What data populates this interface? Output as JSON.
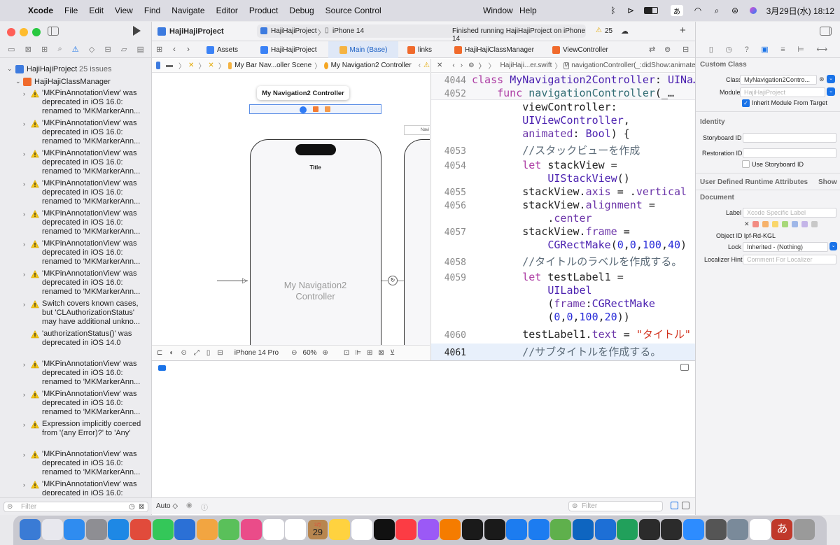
{
  "menubar": {
    "app": "Xcode",
    "items": [
      "File",
      "Edit",
      "View",
      "Find",
      "Navigate",
      "Editor",
      "Product",
      "Debug",
      "Source Control"
    ],
    "center_items": [
      "Window",
      "Help"
    ],
    "input_mode": "あ",
    "datetime": "3月29日(水)  18:12"
  },
  "toolbar": {
    "project": "HajiHajiProject",
    "scheme": "HajiHajiProject",
    "device": "iPhone 14",
    "status": "Finished running HajiHajiProject on iPhone 14",
    "warning_count": "25"
  },
  "navigator": {
    "project_name": "HajiHajiProject",
    "issue_count": "25 issues",
    "group": "HajiHajiClassManager",
    "issues": [
      {
        "text": "'MKPinAnnotationView' was\ndeprecated in iOS 16.0:\nrenamed to 'MKMarkerAnn...",
        "chevron": true
      },
      {
        "text": "'MKPinAnnotationView' was\ndeprecated in iOS 16.0:\nrenamed to 'MKMarkerAnn...",
        "chevron": true
      },
      {
        "text": "'MKPinAnnotationView' was\ndeprecated in iOS 16.0:\nrenamed to 'MKMarkerAnn...",
        "chevron": true
      },
      {
        "text": "'MKPinAnnotationView' was\ndeprecated in iOS 16.0:\nrenamed to 'MKMarkerAnn...",
        "chevron": true
      },
      {
        "text": "'MKPinAnnotationView' was\ndeprecated in iOS 16.0:\nrenamed to 'MKMarkerAnn...",
        "chevron": true
      },
      {
        "text": "'MKPinAnnotationView' was\ndeprecated in iOS 16.0:\nrenamed to 'MKMarkerAnn...",
        "chevron": true
      },
      {
        "text": "'MKPinAnnotationView' was\ndeprecated in iOS 16.0:\nrenamed to 'MKMarkerAnn...",
        "chevron": true
      },
      {
        "text": "Switch covers known cases,\nbut 'CLAuthorizationStatus'\nmay have additional unkno...",
        "chevron": true
      },
      {
        "text": "'authorizationStatus()' was\ndeprecated in iOS 14.0",
        "chevron": false
      },
      {
        "text": "'MKPinAnnotationView' was\ndeprecated in iOS 16.0:\nrenamed to 'MKMarkerAnn...",
        "chevron": true
      },
      {
        "text": "'MKPinAnnotationView' was\ndeprecated in iOS 16.0:\nrenamed to 'MKMarkerAnn...",
        "chevron": true
      },
      {
        "text": "Expression implicitly coerced\nfrom '(any Error)?' to 'Any'",
        "chevron": true
      },
      {
        "text": "'MKPinAnnotationView' was\ndeprecated in iOS 16.0:\nrenamed to 'MKMarkerAnn...",
        "chevron": true
      },
      {
        "text": "'MKPinAnnotationView' was\ndeprecated in iOS 16.0:\nrenamed to 'MKMarkerAnn...",
        "chevron": true
      },
      {
        "text": "'MKPinAnnotationView' was\ndeprecated in iOS 16.0:\nrenamed to 'MKMarkerAnn...",
        "chevron": true
      }
    ],
    "filter_placeholder": "Filter"
  },
  "tabs": [
    {
      "label": "Assets",
      "color": "#3b82f6"
    },
    {
      "label": "HajiHajiProject",
      "color": "#3b82f6"
    },
    {
      "label": "Main (Base)",
      "color": "#f5b342",
      "active": true
    },
    {
      "label": "links",
      "color": "#f06a2c"
    },
    {
      "label": "HajiHajiClassManager",
      "color": "#f06a2c"
    },
    {
      "label": "ViewController",
      "color": "#f06a2c"
    }
  ],
  "ib": {
    "jumpbar": [
      "My Bar Nav...oller Scene",
      "My Navigation2 Controller"
    ],
    "scene_title": "My Navigation2 Controller",
    "phone_title": "Title",
    "controller_label_1": "My Navigation2",
    "controller_label_2": "Controller",
    "side_label": "Navi",
    "device": "iPhone 14 Pro",
    "zoom": "60%"
  },
  "code": {
    "jump_file": "HajiHaji...er.swift",
    "jump_symbol": "navigationController(_:didShow:animated:)",
    "sticky_1_num": "4044",
    "sticky_2_num": "4052"
  },
  "bottombar": {
    "mode": "Auto ◇",
    "filter_placeholder": "Filter"
  },
  "inspector": {
    "custom_class": "Custom Class",
    "class_label": "Class",
    "class_value": "MyNavigation2Contro...",
    "module_label": "Module",
    "module_value": "HajiHajiProject",
    "inherit": "Inherit Module From Target",
    "identity": "Identity",
    "storyboard_id": "Storyboard ID",
    "restoration_id": "Restoration ID",
    "use_storyboard_id": "Use Storyboard ID",
    "runtime_attrs": "User Defined Runtime Attributes",
    "show": "Show",
    "document": "Document",
    "label_label": "Label",
    "label_placeholder": "Xcode Specific Label",
    "object_id_label": "Object ID",
    "object_id": "lpf-Rd-KGL",
    "lock_label": "Lock",
    "lock_value": "Inherited - (Nothing)",
    "localizer_label": "Localizer Hint",
    "localizer_placeholder": "Comment For Localizer",
    "label_colors": [
      "#f28b82",
      "#f6b26b",
      "#f9d66b",
      "#a8d87a",
      "#9fb7e8",
      "#c4b5e8",
      "#c8c8c8"
    ]
  },
  "dock": {
    "date_month": "3月",
    "date_day": "29",
    "ime_char": "あ",
    "icon_colors": [
      "#3a7bd5",
      "#e8e8ee",
      "#2f8cf0",
      "#8e8e93",
      "#1e88e5",
      "#e14b3b",
      "#34c759",
      "#2b70d6",
      "#f2a541",
      "#5ac05a",
      "#ea4c89",
      "#ffffff",
      "#ffffff",
      "#b8864f",
      "#ffd23f",
      "#ffffff",
      "#111111",
      "#fc3c44",
      "#9b59f6",
      "#f57c00",
      "#1a1a1a",
      "#1a1a1a",
      "#1c7cf0",
      "#1c7cf0",
      "#5fb04c",
      "#0e65c0",
      "#1d6fd6",
      "#21a05b",
      "#2b2b2b",
      "#2b2b2b",
      "#2d8cff",
      "#555555",
      "#7a8a9a",
      "#ffffff",
      "#c0392b",
      "#9a9a9a"
    ]
  }
}
